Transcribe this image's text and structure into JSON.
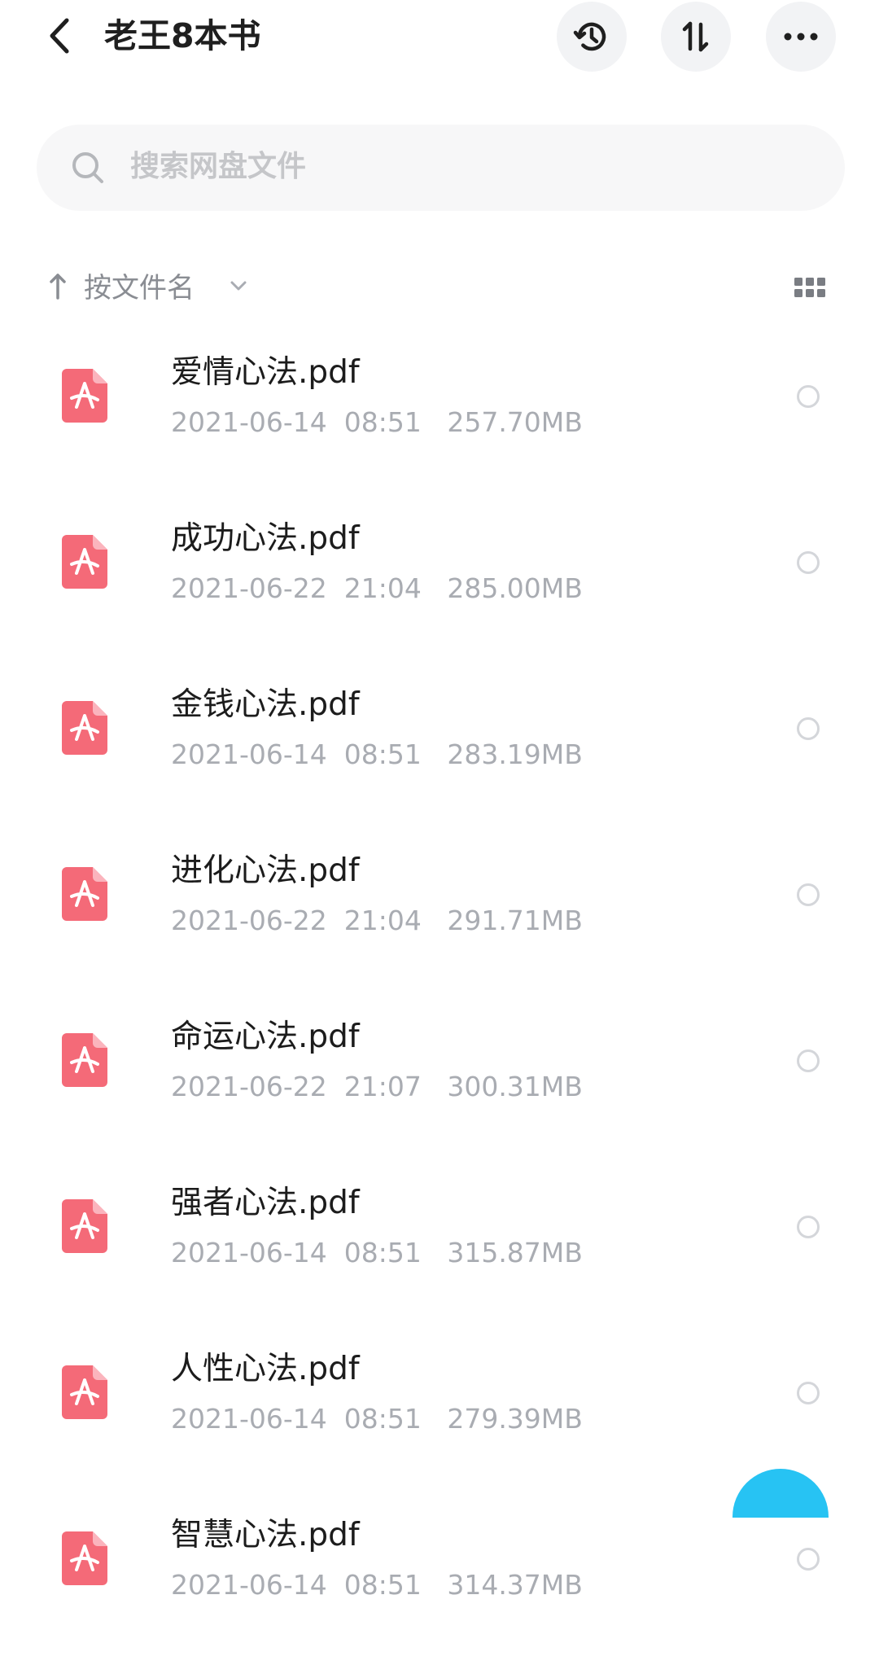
{
  "header": {
    "title": "老王8本书",
    "icons": [
      "back-icon",
      "history-icon",
      "sort-icon",
      "more-icon"
    ]
  },
  "search": {
    "placeholder": "搜索网盘文件"
  },
  "sort": {
    "label": "按文件名"
  },
  "files": [
    {
      "name": "爱情心法.pdf",
      "meta": "2021-06-14  08:51   257.70MB"
    },
    {
      "name": "成功心法.pdf",
      "meta": "2021-06-22  21:04   285.00MB"
    },
    {
      "name": "金钱心法.pdf",
      "meta": "2021-06-14  08:51   283.19MB"
    },
    {
      "name": "进化心法.pdf",
      "meta": "2021-06-22  21:04   291.71MB"
    },
    {
      "name": "命运心法.pdf",
      "meta": "2021-06-22  21:07   300.31MB"
    },
    {
      "name": "强者心法.pdf",
      "meta": "2021-06-14  08:51   315.87MB"
    },
    {
      "name": "人性心法.pdf",
      "meta": "2021-06-14  08:51   279.39MB"
    },
    {
      "name": "智慧心法.pdf",
      "meta": "2021-06-14  08:51   314.37MB"
    }
  ],
  "colors": {
    "pdf_icon": "#f46a78",
    "fab": "#27c3f3",
    "secondary_text": "#a9acb2"
  }
}
